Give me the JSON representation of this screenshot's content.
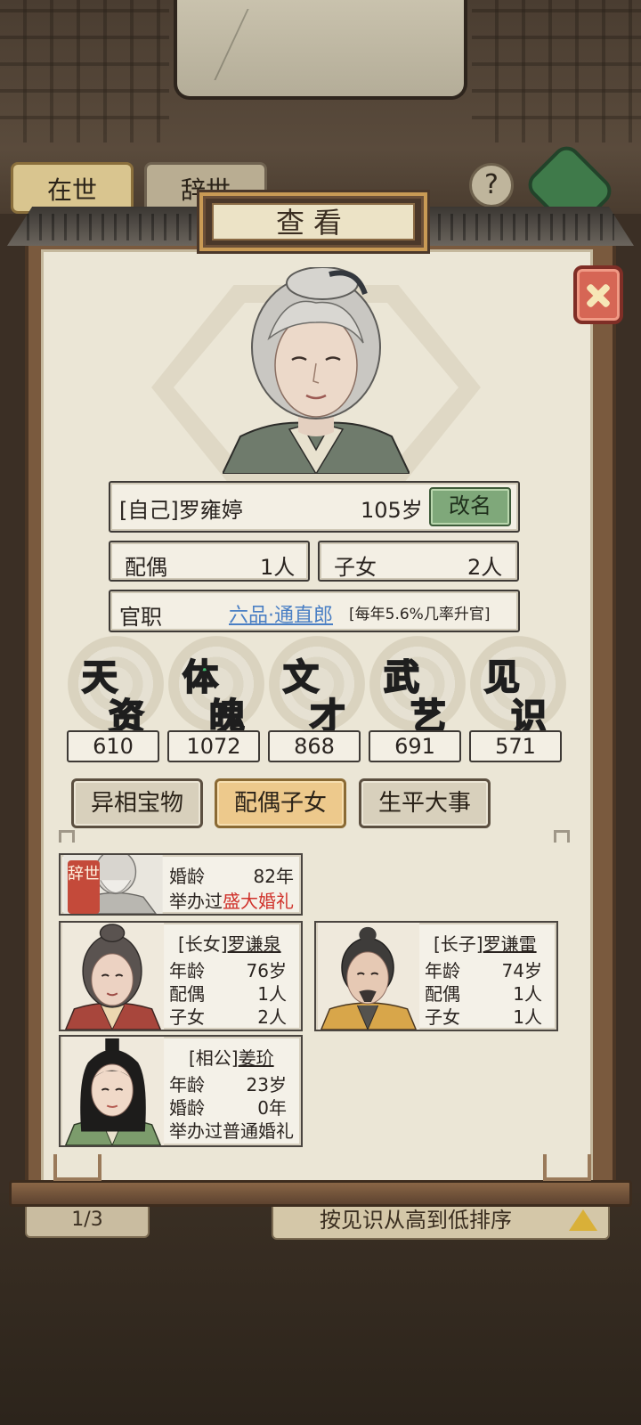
{
  "background": {
    "tab_alive": "在世",
    "tab_deceased": "辞世",
    "help_icon_text": "?",
    "page_indicator": "1/3",
    "sort_label": "按见识从高到低排序"
  },
  "popup": {
    "title": "查看",
    "self": {
      "name_line": "[自己]罗雍婷",
      "age": "105岁",
      "rename_label": "改名",
      "spouse_label": "配偶",
      "spouse_count": "1人",
      "children_label": "子女",
      "children_count": "2人",
      "office_label": "官职",
      "office_value": "六品·通直郎",
      "office_note": "[每年5.6%几率升官]"
    },
    "attributes": [
      {
        "name_top": "天",
        "name_bottom": "资",
        "value": "610",
        "color": "#4a7fe0"
      },
      {
        "name_top": "体",
        "name_bottom": "魄",
        "value": "1072",
        "color": "#3fbf6e"
      },
      {
        "name_top": "文",
        "name_bottom": "才",
        "value": "868",
        "color": "#b45ad8"
      },
      {
        "name_top": "武",
        "name_bottom": "艺",
        "value": "691",
        "color": "#e2b32c"
      },
      {
        "name_top": "见",
        "name_bottom": "识",
        "value": "571",
        "color": "#e0666e"
      }
    ],
    "tabs": [
      "异相宝物",
      "配偶子女",
      "生平大事"
    ],
    "active_tab": "配偶子女",
    "members": {
      "deceased_spouse": {
        "tag": "辞世",
        "marriage_age_label": "婚龄",
        "marriage_age": "82年",
        "wedding_prefix": "举办过",
        "wedding_type": "盛大婚礼"
      },
      "eldest_daughter": {
        "relation": "[长女]",
        "name": "罗谦泉",
        "age_label": "年龄",
        "age": "76岁",
        "spouse_label": "配偶",
        "spouse": "1人",
        "children_label": "子女",
        "children": "2人"
      },
      "eldest_son": {
        "relation": "[长子]",
        "name": "罗谦雷",
        "age_label": "年龄",
        "age": "74岁",
        "spouse_label": "配偶",
        "spouse": "1人",
        "children_label": "子女",
        "children": "1人"
      },
      "husband": {
        "relation": "[相公]",
        "name": "姜玠",
        "age_label": "年龄",
        "age": "23岁",
        "marriage_age_label": "婚龄",
        "marriage_age": "0年",
        "wedding_text": "举办过普通婚礼"
      }
    }
  }
}
